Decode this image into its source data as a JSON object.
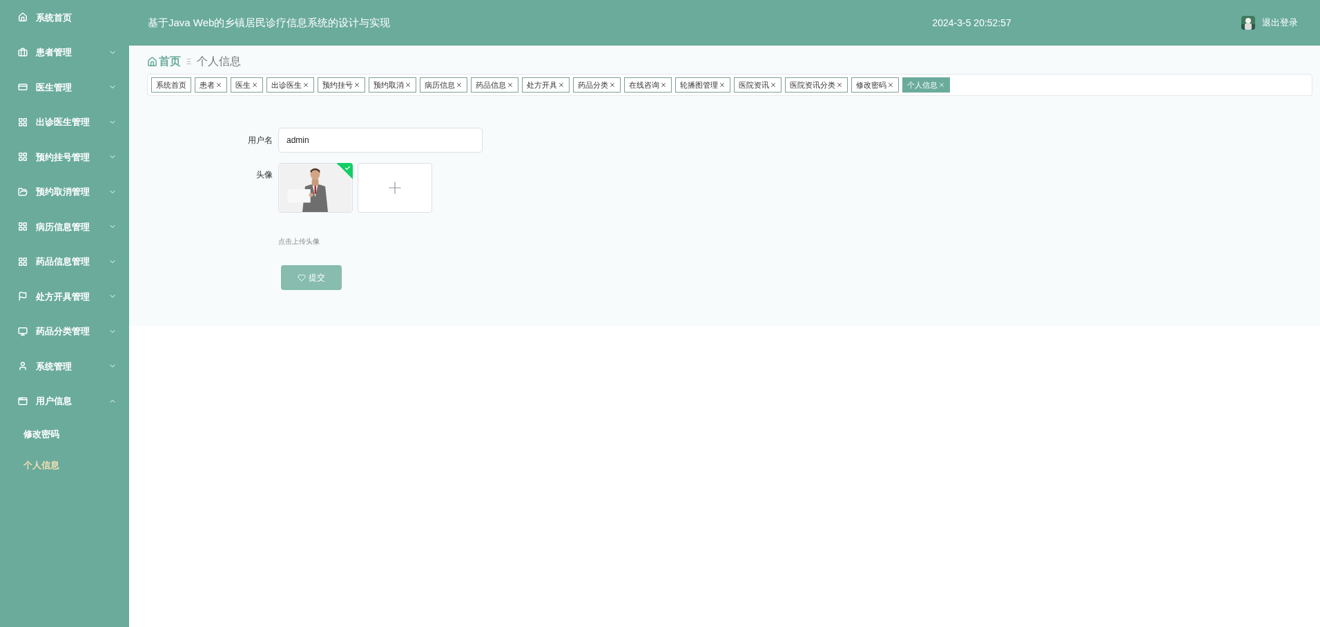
{
  "header": {
    "title": "基于Java Web的乡镇居民诊疗信息系统的设计与实现",
    "datetime": "2024-3-5 20:52:57",
    "logout": "退出登录"
  },
  "sidebar": {
    "items": [
      {
        "label": "系统首页",
        "kind": "link"
      },
      {
        "label": "患者管理",
        "kind": "menu",
        "expanded": false
      },
      {
        "label": "医生管理",
        "kind": "menu",
        "expanded": false
      },
      {
        "label": "出诊医生管理",
        "kind": "menu",
        "expanded": false
      },
      {
        "label": "预约挂号管理",
        "kind": "menu",
        "expanded": false
      },
      {
        "label": "预约取消管理",
        "kind": "menu",
        "expanded": false
      },
      {
        "label": "病历信息管理",
        "kind": "menu",
        "expanded": false
      },
      {
        "label": "药品信息管理",
        "kind": "menu",
        "expanded": false
      },
      {
        "label": "处方开具管理",
        "kind": "menu",
        "expanded": false
      },
      {
        "label": "药品分类管理",
        "kind": "menu",
        "expanded": false
      },
      {
        "label": "系统管理",
        "kind": "menu",
        "expanded": false
      },
      {
        "label": "用户信息",
        "kind": "menu",
        "expanded": true,
        "children": [
          {
            "label": "修改密码",
            "selected": false
          },
          {
            "label": "个人信息",
            "selected": true
          }
        ]
      }
    ]
  },
  "breadcrumb": {
    "home": "首页",
    "separator": "Ξ",
    "current": "个人信息"
  },
  "tags": [
    {
      "label": "系统首页",
      "closable": false,
      "selected": false
    },
    {
      "label": "患者",
      "closable": true,
      "selected": false
    },
    {
      "label": "医生",
      "closable": true,
      "selected": false
    },
    {
      "label": "出诊医生",
      "closable": true,
      "selected": false
    },
    {
      "label": "预约挂号",
      "closable": true,
      "selected": false
    },
    {
      "label": "预约取消",
      "closable": true,
      "selected": false
    },
    {
      "label": "病历信息",
      "closable": true,
      "selected": false
    },
    {
      "label": "药品信息",
      "closable": true,
      "selected": false
    },
    {
      "label": "处方开具",
      "closable": true,
      "selected": false
    },
    {
      "label": "药品分类",
      "closable": true,
      "selected": false
    },
    {
      "label": "在线咨询",
      "closable": true,
      "selected": false
    },
    {
      "label": "轮播图管理",
      "closable": true,
      "selected": false
    },
    {
      "label": "医院资讯",
      "closable": true,
      "selected": false
    },
    {
      "label": "医院资讯分类",
      "closable": true,
      "selected": false
    },
    {
      "label": "修改密码",
      "closable": true,
      "selected": false
    },
    {
      "label": "个人信息",
      "closable": true,
      "selected": true
    }
  ],
  "form": {
    "username": {
      "label": "用户名",
      "value": "admin"
    },
    "avatar": {
      "label": "头像",
      "uploaded": true,
      "hint": "点击上传头像"
    },
    "submit": "提交"
  }
}
